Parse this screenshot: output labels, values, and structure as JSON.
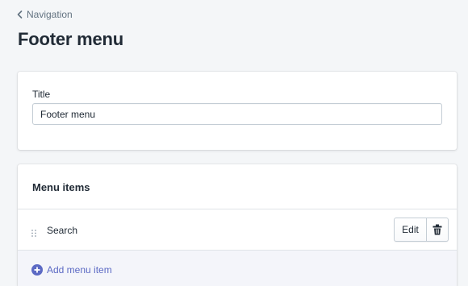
{
  "breadcrumb": {
    "label": "Navigation"
  },
  "page": {
    "title": "Footer menu"
  },
  "title_card": {
    "field_label": "Title",
    "field_value": "Footer menu"
  },
  "menu_card": {
    "heading": "Menu items",
    "items": [
      {
        "label": "Search",
        "edit_label": "Edit"
      }
    ],
    "add_label": "Add menu item"
  },
  "colors": {
    "accent": "#5c6ac4",
    "page_bg": "#f4f6f8",
    "text": "#212b36",
    "subdued_text": "#637381"
  },
  "icons": [
    "chevron-left-icon",
    "drag-handle-icon",
    "trash-icon",
    "plus-circle-icon"
  ]
}
